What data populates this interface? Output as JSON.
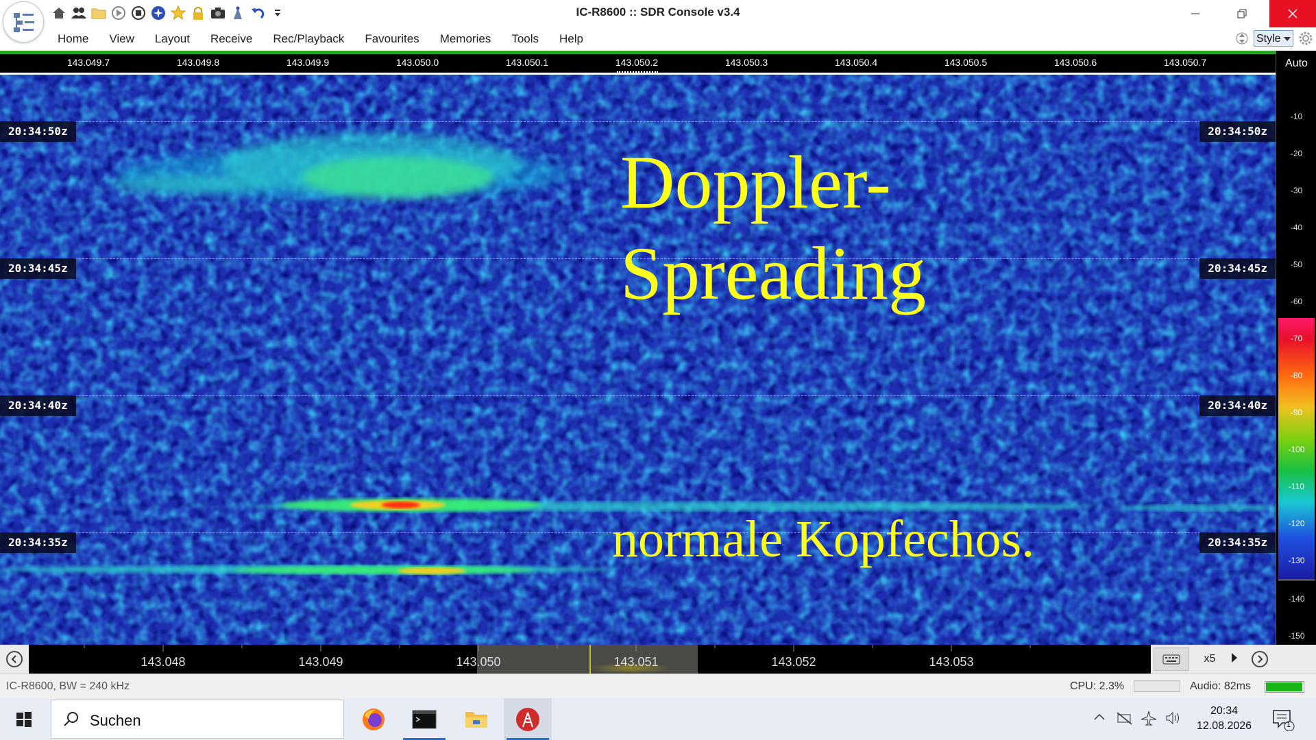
{
  "window": {
    "title": "IC-R8600 :: SDR Console v3.4",
    "quick_access": [
      "home-icon",
      "users-icon",
      "folder-icon",
      "play-icon",
      "stop-icon",
      "compass-icon",
      "star-icon",
      "lock-icon",
      "camera-icon",
      "antenna-icon",
      "undo-icon",
      "dropdown-icon"
    ]
  },
  "menu": {
    "items": [
      "Home",
      "View",
      "Layout",
      "Receive",
      "Rec/Playback",
      "Favourites",
      "Memories",
      "Tools",
      "Help"
    ],
    "style_label": "Style"
  },
  "freq_scale": {
    "labels": [
      "143.049.7",
      "143.049.8",
      "143.049.9",
      "143.050.0",
      "143.050.1",
      "143.050.2",
      "143.050.3",
      "143.050.4",
      "143.050.5",
      "143.050.6",
      "143.050.7"
    ]
  },
  "waterfall": {
    "time_labels": [
      "20:34:50z",
      "20:34:45z",
      "20:34:40z",
      "20:34:35z"
    ],
    "annotations": {
      "doppler_line1": "Doppler-",
      "doppler_line2": "Spreading",
      "head_echoes": "normale Kopfechos."
    }
  },
  "level_scale": {
    "auto_label": "Auto",
    "ticks_upper": [
      "-10",
      "-20",
      "-30",
      "-40",
      "-50",
      "-60"
    ],
    "ticks_color": [
      "-70",
      "-80",
      "-90",
      "-100",
      "-110",
      "-120",
      "-130"
    ],
    "ticks_lower": [
      "-140",
      "-150"
    ]
  },
  "bottom": {
    "freq_labels": [
      "143.048",
      "143.049",
      "143.050",
      "143.051",
      "143.052",
      "143.053"
    ],
    "zoom": "x5"
  },
  "status": {
    "radio": "IC-R8600, BW = 240 kHz",
    "cpu": "CPU: 2.3%",
    "audio": "Audio: 82ms"
  },
  "taskbar": {
    "search_placeholder": "Suchen",
    "time": "20:34",
    "date": "12.08.2026",
    "notification_count": "1"
  },
  "colors": {
    "waterfall_background": "#1d2fb0",
    "annotation_text": "#ffff1e",
    "signal_band": "#3cf0d0",
    "signal_peak": "#ff2a10"
  }
}
